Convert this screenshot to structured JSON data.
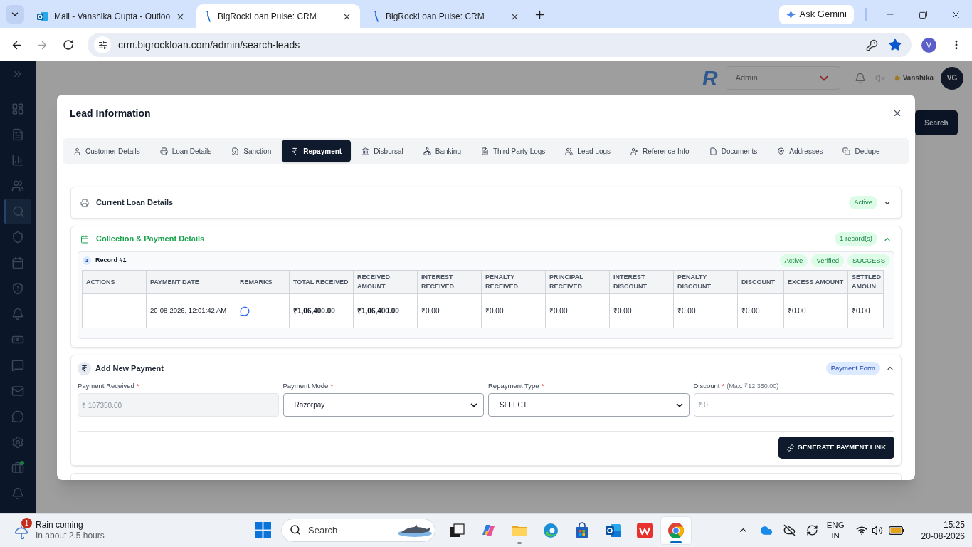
{
  "browser": {
    "tabs": [
      {
        "kind": "mail",
        "title": "Mail - Vanshika Gupta - Outloo",
        "selected": false
      },
      {
        "kind": "crm",
        "title": "BigRockLoan Pulse: CRM",
        "selected": true
      },
      {
        "kind": "crm",
        "title": "BigRockLoan Pulse: CRM",
        "selected": false
      }
    ],
    "gemini_button": "Ask Gemini",
    "url": "crm.bigrockloan.com/admin/search-leads",
    "bookmarked": true,
    "profile_initial": "V"
  },
  "app_background": {
    "logo_letter": "R",
    "role_select": "Admin",
    "user_name": "Vanshika",
    "user_initials": "VG",
    "search_button": "Search",
    "sidebar": {
      "items": [
        {
          "selected": false,
          "dot": false
        },
        {
          "selected": false,
          "dot": false
        },
        {
          "selected": false,
          "dot": false
        },
        {
          "selected": false,
          "dot": false
        },
        {
          "selected": true,
          "dot": false
        },
        {
          "selected": false,
          "dot": false
        },
        {
          "selected": false,
          "dot": false
        },
        {
          "selected": false,
          "dot": false
        },
        {
          "selected": false,
          "dot": false
        },
        {
          "selected": false,
          "dot": false
        },
        {
          "selected": false,
          "dot": false
        },
        {
          "selected": false,
          "dot": false
        },
        {
          "selected": false,
          "dot": false
        },
        {
          "selected": false,
          "dot": false
        },
        {
          "selected": false,
          "dot": true
        },
        {
          "selected": false,
          "dot": false
        }
      ]
    }
  },
  "modal": {
    "title": "Lead Information",
    "tabs": [
      {
        "label": "Customer Details",
        "selected": false
      },
      {
        "label": "Loan Details",
        "selected": false
      },
      {
        "label": "Sanction",
        "selected": false
      },
      {
        "label": "Repayment",
        "selected": true
      },
      {
        "label": "Disbursal",
        "selected": false
      },
      {
        "label": "Banking",
        "selected": false
      },
      {
        "label": "Third Party Logs",
        "selected": false
      },
      {
        "label": "Lead Logs",
        "selected": false
      },
      {
        "label": "Reference Info",
        "selected": false
      },
      {
        "label": "Documents",
        "selected": false
      },
      {
        "label": "Addresses",
        "selected": false
      },
      {
        "label": "Dedupe",
        "selected": false
      }
    ],
    "current_loan": {
      "title": "Current Loan Details",
      "badge": "Active",
      "expanded": false
    },
    "collection": {
      "title": "Collection & Payment Details",
      "badge": "1 record(s)",
      "expanded": true,
      "records": [
        {
          "number": "1",
          "title": "Record #1",
          "badges": [
            "Active",
            "Verified",
            "SUCCESS"
          ],
          "columns": [
            "ACTIONS",
            "PAYMENT DATE",
            "REMARKS",
            "TOTAL RECEIVED",
            "RECEIVED AMOUNT",
            "INTEREST RECEIVED",
            "PENALTY RECEIVED",
            "PRINCIPAL RECEIVED",
            "INTEREST DISCOUNT",
            "PENALTY DISCOUNT",
            "DISCOUNT",
            "EXCESS AMOUNT",
            "SETTLED AMOUN"
          ],
          "rows": [
            {
              "payment_date": "20-08-2026, 12:01:42 AM",
              "remark": true,
              "amounts": [
                "₹1,06,400.00",
                "₹1,06,400.00",
                "₹0.00",
                "₹0.00",
                "₹0.00",
                "₹0.00",
                "₹0.00",
                "₹0.00",
                "₹0.00",
                "₹0.00"
              ]
            }
          ]
        }
      ]
    },
    "add_payment": {
      "title": "Add New Payment",
      "badge": "Payment Form",
      "expanded": true,
      "fields": [
        {
          "kind": "text",
          "label": "Payment Received",
          "required_mark": "*",
          "value": "₹ 107350.00",
          "disabled": true
        },
        {
          "kind": "select",
          "label": "Payment Mode",
          "required_mark": "*",
          "value": "Razorpay"
        },
        {
          "kind": "select",
          "label": "Repayment Type",
          "required_mark": "*",
          "value": "SELECT"
        },
        {
          "kind": "text",
          "label": "Discount",
          "required_mark": "*",
          "hint": "(Max: ₹12,350.00)",
          "placeholder": "₹ 0",
          "disabled": false
        }
      ],
      "button": "GENERATE PAYMENT LINK"
    }
  },
  "taskbar": {
    "weather": {
      "badge": "1",
      "title": "Rain coming",
      "subtitle": "In about 2.5 hours"
    },
    "search_placeholder": "Search",
    "apps": [
      {
        "running": false,
        "selected": false
      },
      {
        "running": false,
        "selected": false
      },
      {
        "running": true,
        "selected": false
      },
      {
        "running": false,
        "selected": false
      },
      {
        "running": false,
        "selected": false
      },
      {
        "running": false,
        "selected": false
      },
      {
        "running": false,
        "selected": false
      },
      {
        "running": true,
        "selected": true
      }
    ],
    "language": "ENG",
    "region": "IN",
    "time": "15:25",
    "date": "20-08-2026"
  }
}
